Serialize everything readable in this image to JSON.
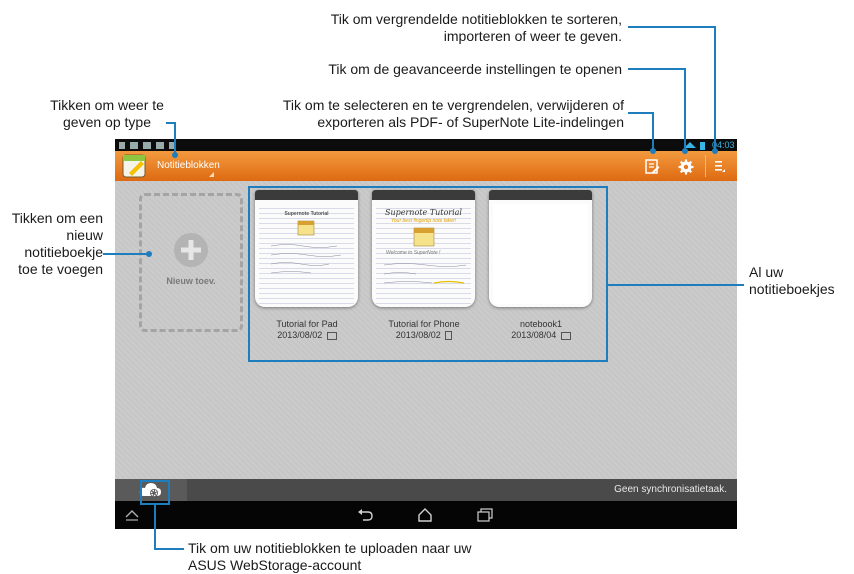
{
  "callouts": {
    "sort_locked": "Tik om vergrendelde notitieblokken te sorteren, importeren of weer te geven.",
    "advanced_settings": "Tik om de geavanceerde instellingen te openen",
    "select_lock": "Tik om te selecteren en te vergrendelen, verwijderen of exporteren als PDF- of SuperNote Lite-indelingen",
    "display_type": "Tikken om weer te geven op type",
    "add_new": "Tikken om een nieuw notitieboekje toe te voegen",
    "all_notebooks": "Al uw notitieboekjes",
    "upload": "Tik om uw notitieblokken te uploaden naar uw ASUS WebStorage-account"
  },
  "status_bar": {
    "time": "04:03"
  },
  "action_bar": {
    "title": "Notitieblokken"
  },
  "add_card": {
    "label": "Nieuw toev."
  },
  "notebooks": [
    {
      "name": "Tutorial for Pad",
      "date": "2013/08/02",
      "cover_title": "Supernote Tutorial"
    },
    {
      "name": "Tutorial for Phone",
      "date": "2013/08/02",
      "cover_title": "Supernote Tutorial",
      "cover_subtitle": "Your best fingertip note taker!",
      "cover_welcome": "Welcome to SuperNote !"
    },
    {
      "name": "notebook1",
      "date": "2013/08/04"
    }
  ],
  "bottom_bar": {
    "sync_status": "Geen synchronisatietaak."
  },
  "colors": {
    "action_bar": "#e9822a",
    "leader_line": "#1e7dbd",
    "content_bg": "#c9c9c9"
  },
  "icons": [
    "notebook-app-icon",
    "select-edit-icon",
    "gear-icon",
    "menu-icon",
    "add-icon",
    "cloud-settings-icon",
    "back-icon",
    "home-icon",
    "recent-apps-icon"
  ]
}
